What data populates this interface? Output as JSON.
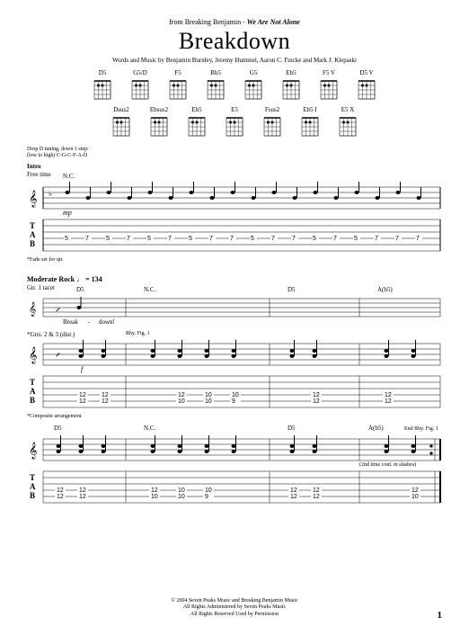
{
  "header": {
    "from_prefix": "from Breaking Benjamin -",
    "album": "We Are Not Alone",
    "title": "Breakdown",
    "credits": "Words and Music by Benjamin Burnley, Jeremy Hummel, Aaron C. Fincke and Mark J. Klepaski"
  },
  "chord_row1": [
    "D5",
    "G5/D",
    "F5",
    "Bb5",
    "G5",
    "Eb5",
    "F5 V",
    "D5 V"
  ],
  "chord_row2": [
    "Dsus2",
    "Ebsus2",
    "Eb5",
    "E5",
    "Fsus2",
    "Eb5 I",
    "E5 X"
  ],
  "tuning": {
    "line1": "Drop D tuning, down 1 step:",
    "line2": "(low to high) C-G-C-F-A-D"
  },
  "intro": {
    "label": "Intro",
    "sub": "Free time",
    "nc": "N.C.",
    "dyn": "mp",
    "tab_row": [
      "5",
      "7",
      "5",
      "7",
      "5",
      "7",
      "5",
      "7",
      "7",
      "5",
      "7",
      "7",
      "5",
      "7",
      "5",
      "7",
      "7",
      "7"
    ],
    "footnote": "*Fade set for qtr."
  },
  "system2": {
    "tempo_label": "Moderate Rock",
    "tempo_val": "= 134",
    "gtr1": "Gtr. 1 tacet",
    "chords": [
      "D5",
      "N.C.",
      "D5",
      "A(b5)"
    ],
    "lyric1": "Break",
    "lyric2": "down!",
    "gtr23": "*Gtrs. 2 & 3 (dist.)",
    "rhy": "Rhy. Fig. 1",
    "dyn": "f",
    "tab_pairs": [
      [
        "12",
        "12"
      ],
      [
        "12",
        "12"
      ],
      [
        "",
        ""
      ],
      [
        "12",
        "10"
      ],
      [
        "10",
        "10"
      ],
      [
        "10",
        "9"
      ],
      [
        "",
        ""
      ]
    ],
    "footnote": "*Composite arrangement"
  },
  "system3": {
    "chords": [
      "D5",
      "N.C.",
      "D5",
      "A(b5)"
    ],
    "end_rhy": "End Rhy. Fig. 1",
    "note": "(2nd time cont. in slashes)",
    "tab_pairs": [
      [
        "12",
        "12"
      ],
      [
        "12",
        "12"
      ],
      [
        "",
        ""
      ],
      [
        "12",
        "10"
      ],
      [
        "10",
        "10"
      ],
      [
        "10",
        "9"
      ],
      [
        "",
        ""
      ]
    ]
  },
  "copyright": {
    "l1": "© 2004 Seven Peaks Music and Breaking Benjamin Music",
    "l2": "All Rights Administered by Seven Peaks Music",
    "l3": "All Rights Reserved   Used by Permission"
  },
  "page_num": "1"
}
